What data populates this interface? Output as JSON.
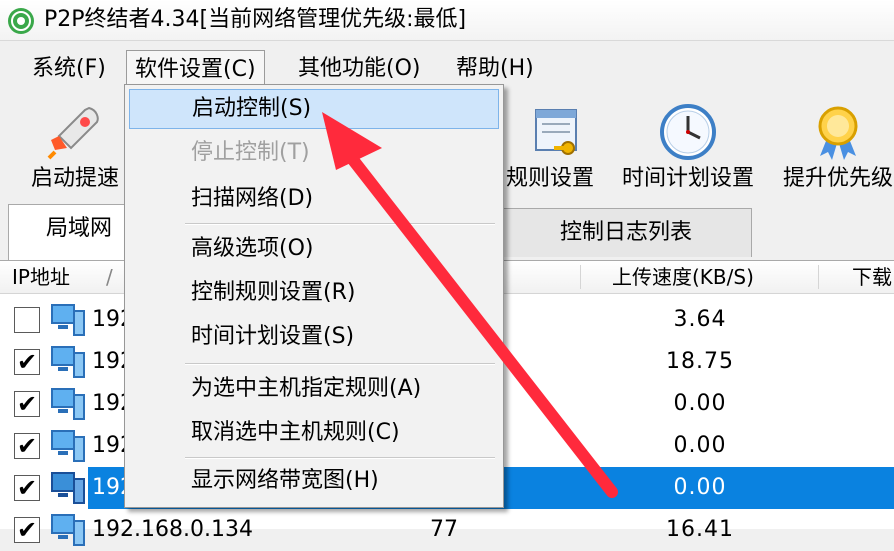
{
  "window": {
    "title": "P2P终结者4.34[当前网络管理优先级:最低]"
  },
  "menubar": {
    "items": [
      {
        "label": "系统(F)"
      },
      {
        "label": "软件设置(C)"
      },
      {
        "label": "其他功能(O)"
      },
      {
        "label": "帮助(H)"
      }
    ]
  },
  "toolbar": {
    "items": [
      {
        "label": "启动提速",
        "icon": "rocket-icon"
      },
      {
        "label": "规则设置",
        "icon": "rules-key-icon"
      },
      {
        "label": "时间计划设置",
        "icon": "clock-icon"
      },
      {
        "label": "提升优先级",
        "icon": "award-ribbon-icon"
      }
    ]
  },
  "tabs": [
    {
      "label": "局域网"
    },
    {
      "label": "控制日志列表"
    }
  ],
  "list": {
    "headers": {
      "ip": "IP地址",
      "sort_indicator": "/",
      "upload": "上传速度(KB/S)",
      "download": "下载"
    },
    "rows": [
      {
        "checked": "",
        "ip": "192",
        "upload": "3.64",
        "extra": ""
      },
      {
        "checked": "✔",
        "ip": "192",
        "upload": "18.75",
        "extra": ""
      },
      {
        "checked": "✔",
        "ip": "192",
        "upload": "0.00",
        "extra": ""
      },
      {
        "checked": "✔",
        "ip": "192",
        "upload": "0.00",
        "extra": ""
      },
      {
        "checked": "✔",
        "ip": "192",
        "upload": "0.00",
        "extra": "",
        "selected": true
      },
      {
        "checked": "✔",
        "ip": "192.168.0.134",
        "upload": "16.41",
        "extra": "77"
      }
    ]
  },
  "dropdown": {
    "items": [
      {
        "label": "启动控制(S)",
        "state": "highlighted"
      },
      {
        "label": "停止控制(T)",
        "state": "disabled"
      },
      {
        "label": "扫描网络(D)",
        "state": "normal"
      },
      {
        "label": "高级选项(O)",
        "state": "normal"
      },
      {
        "label": "控制规则设置(R)",
        "state": "normal"
      },
      {
        "label": "时间计划设置(S)",
        "state": "normal"
      },
      {
        "label": "为选中主机指定规则(A)",
        "state": "normal"
      },
      {
        "label": "取消选中主机规则(C)",
        "state": "normal"
      },
      {
        "label": "显示网络带宽图(H)",
        "state": "normal"
      }
    ]
  },
  "colors": {
    "selection": "#0a82e0",
    "menu_highlight": "#cfe5fb",
    "annotation_arrow": "#ff2a3c"
  }
}
